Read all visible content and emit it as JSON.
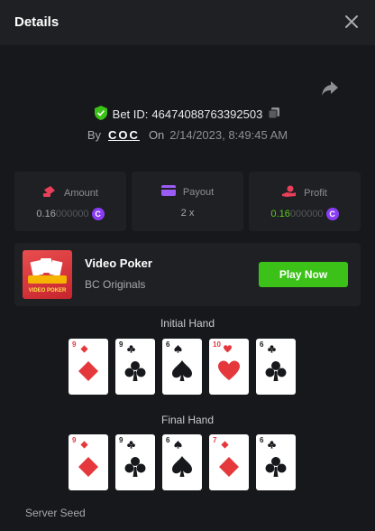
{
  "header": {
    "title": "Details",
    "close_icon": "close-icon"
  },
  "bet": {
    "bet_id_label": "Bet ID:",
    "bet_id": "46474088763392503",
    "by_label": "By",
    "user": "COC",
    "on_label": "On",
    "date": "2/14/2023, 8:49:45 AM"
  },
  "stats": {
    "amount": {
      "label": "Amount",
      "value_main": "0.16",
      "value_dim": "000000",
      "icon": "money-icon",
      "currency_icon": "coin-icon"
    },
    "payout": {
      "label": "Payout",
      "value": "2 x",
      "icon": "card-icon"
    },
    "profit": {
      "label": "Profit",
      "value_main": "0.16",
      "value_dim": "000000",
      "icon": "hand-coin-icon",
      "currency_icon": "coin-icon"
    }
  },
  "game": {
    "name": "Video Poker",
    "provider": "BC Originals",
    "thumb_label": "VIDEO POKER",
    "play_label": "Play Now"
  },
  "initial_hand": {
    "title": "Initial Hand",
    "cards": [
      {
        "rank": "9",
        "suit": "diamond",
        "color": "red"
      },
      {
        "rank": "9",
        "suit": "club",
        "color": "black"
      },
      {
        "rank": "6",
        "suit": "spade",
        "color": "black"
      },
      {
        "rank": "10",
        "suit": "heart",
        "color": "red"
      },
      {
        "rank": "6",
        "suit": "club",
        "color": "black"
      }
    ]
  },
  "final_hand": {
    "title": "Final Hand",
    "cards": [
      {
        "rank": "9",
        "suit": "diamond",
        "color": "red"
      },
      {
        "rank": "9",
        "suit": "club",
        "color": "black"
      },
      {
        "rank": "6",
        "suit": "spade",
        "color": "black"
      },
      {
        "rank": "7",
        "suit": "diamond",
        "color": "red"
      },
      {
        "rank": "6",
        "suit": "club",
        "color": "black"
      }
    ]
  },
  "server_seed_label": "Server Seed",
  "colors": {
    "accent_green": "#3bc117",
    "profit_green": "#5ecd1a",
    "card_red": "#e4383c",
    "coin_purple": "#8a3cf5",
    "bg": "#17181b",
    "panel": "#1f2024"
  }
}
